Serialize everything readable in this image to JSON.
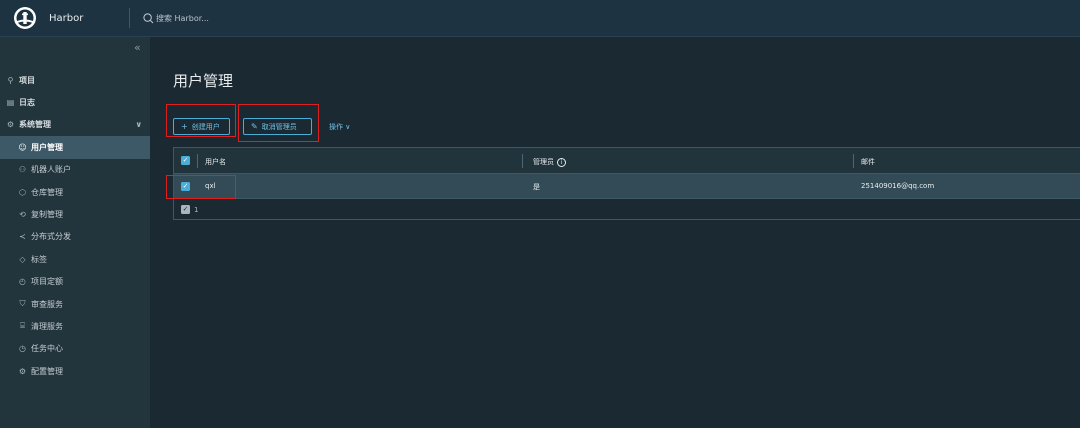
{
  "header": {
    "brand_name": "Harbor",
    "search_placeholder": "搜索 Harbor..."
  },
  "sidebar": {
    "collapse_glyph": "«",
    "items": [
      {
        "label": "项目",
        "icon": "projects-icon",
        "glyph": "⚲",
        "level": "top"
      },
      {
        "label": "日志",
        "icon": "logs-icon",
        "glyph": "▤",
        "level": "top"
      },
      {
        "label": "系统管理",
        "icon": "admin-icon",
        "glyph": "⚙",
        "level": "top",
        "expanded": true
      },
      {
        "label": "用户管理",
        "icon": "users-icon",
        "glyph": "☺",
        "level": "sub",
        "active": true
      },
      {
        "label": "机器人账户",
        "icon": "robot-icon",
        "glyph": "⚇",
        "level": "sub"
      },
      {
        "label": "仓库管理",
        "icon": "registry-icon",
        "glyph": "⬡",
        "level": "sub"
      },
      {
        "label": "复制管理",
        "icon": "replication-icon",
        "glyph": "⟲",
        "level": "sub"
      },
      {
        "label": "分布式分发",
        "icon": "distribution-icon",
        "glyph": "≺",
        "level": "sub"
      },
      {
        "label": "标签",
        "icon": "tag-icon",
        "glyph": "◇",
        "level": "sub"
      },
      {
        "label": "项目定额",
        "icon": "quota-icon",
        "glyph": "◴",
        "level": "sub"
      },
      {
        "label": "审查服务",
        "icon": "shield-icon",
        "glyph": "⛉",
        "level": "sub"
      },
      {
        "label": "清理服务",
        "icon": "trash-icon",
        "glyph": "⌸",
        "level": "sub"
      },
      {
        "label": "任务中心",
        "icon": "clock-icon",
        "glyph": "◷",
        "level": "sub"
      },
      {
        "label": "配置管理",
        "icon": "gear-icon",
        "glyph": "⚙",
        "level": "sub"
      }
    ]
  },
  "main": {
    "page_title": "用户管理",
    "create_user_label": "创建用户",
    "revoke_admin_label": "取消管理员",
    "operations_label": "操作",
    "table": {
      "columns": [
        "用户名",
        "管理员",
        "邮件"
      ],
      "rows": [
        {
          "username": "qxl",
          "admin": "是",
          "email": "251409016@qq.com",
          "selected": true
        }
      ],
      "footer_selected_count": "1"
    }
  },
  "colors": {
    "accent": "#4aaed9",
    "highlight_box": "#e02020",
    "sidebar_bg": "#22343c",
    "main_bg": "#1b2a32"
  }
}
